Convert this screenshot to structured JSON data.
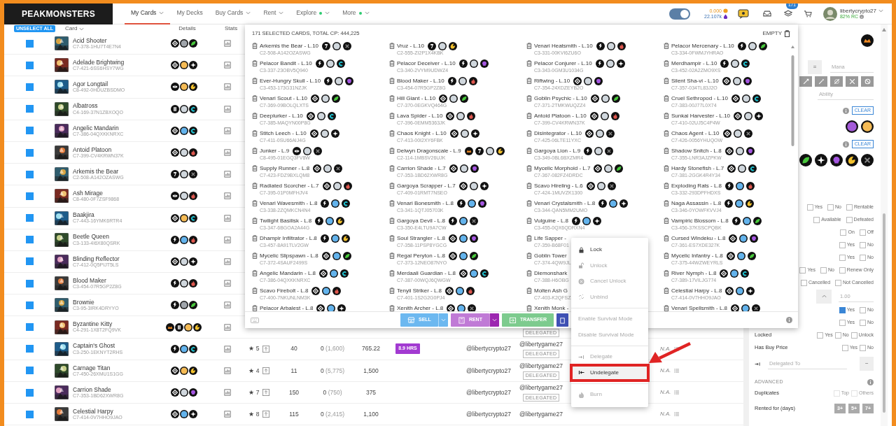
{
  "navbar": {
    "logo": "PEAKMONSTERS",
    "links": [
      {
        "label": "My Cards",
        "selected": true,
        "caret": true,
        "dot": false
      },
      {
        "label": "My Decks",
        "selected": false,
        "caret": false,
        "dot": false
      },
      {
        "label": "Buy Cards",
        "selected": false,
        "caret": true,
        "dot": false
      },
      {
        "label": "Rent",
        "selected": false,
        "caret": true,
        "dot": false
      },
      {
        "label": "Explore",
        "selected": false,
        "caret": true,
        "dot": true
      },
      {
        "label": "More",
        "selected": false,
        "caret": true,
        "dot": true
      }
    ],
    "toggle_on": true,
    "balance_primary": "0.000",
    "balance_secondary": "22.107k",
    "notifications": "171",
    "username": "libertycrypto27",
    "rc": "82% RC"
  },
  "table": {
    "unselect_all": "UNSELECT ALL",
    "columns": [
      "Card",
      "Details",
      "Stats"
    ],
    "rows": [
      {
        "selected": true,
        "name": "Acid Shooter",
        "id": "C7-378-1HU7T4E7N4",
        "icons": [
          {
            "kind": "chaos"
          },
          {
            "kind": "dark"
          },
          {
            "kind": "earth"
          }
        ]
      },
      {
        "selected": true,
        "name": "Adelade Brightwing",
        "id": "C7-421-6SS6HSY7WG",
        "icons": [
          {
            "kind": "chaos"
          },
          {
            "kind": "gold"
          },
          {
            "kind": "life"
          }
        ]
      },
      {
        "selected": true,
        "name": "Agor Longtail",
        "id": "C8-492-0HDUZBSDMO",
        "icons": [
          {
            "kind": "gladius"
          },
          {
            "kind": "gold"
          },
          {
            "kind": "dragon"
          }
        ]
      },
      {
        "selected": true,
        "name": "Albatross",
        "id": "C4-169-37N1ZBXOQO",
        "icons": [
          {
            "kind": "untamed"
          },
          {
            "kind": "silver"
          },
          {
            "kind": "water"
          }
        ]
      },
      {
        "selected": true,
        "name": "Angelic Mandarin",
        "id": "C7-386-04QXKKNRXC",
        "icons": [
          {
            "kind": "chaos"
          },
          {
            "kind": "blue"
          },
          {
            "kind": "water"
          }
        ]
      },
      {
        "selected": true,
        "name": "Antoid Platoon",
        "id": "C7-399-CV4KRWN37K",
        "icons": [
          {
            "kind": "chaos"
          },
          {
            "kind": "silver"
          },
          {
            "kind": "fire"
          }
        ]
      },
      {
        "selected": true,
        "name": "Arkemis the Bear",
        "id": "C2-508-A142OZASWG",
        "icons": [
          {
            "kind": "beta"
          },
          {
            "kind": "silver"
          },
          {
            "kind": "neutral"
          }
        ]
      },
      {
        "selected": true,
        "name": "Ash Mirage",
        "id": "C8-480-0F7ZSF9868",
        "icons": [
          {
            "kind": "gladius"
          },
          {
            "kind": "silver"
          },
          {
            "kind": "fire"
          }
        ]
      },
      {
        "selected": true,
        "name": "Baakjira",
        "id": "C7-443-16YMK6RTR4",
        "icons": [
          {
            "kind": "chaos"
          },
          {
            "kind": "gold"
          },
          {
            "kind": "water"
          }
        ]
      },
      {
        "selected": true,
        "name": "Beetle Queen",
        "id": "C3-133-4I6X80QSRK",
        "icons": [
          {
            "kind": "runner"
          },
          {
            "kind": "blue"
          },
          {
            "kind": "fire"
          }
        ]
      },
      {
        "selected": true,
        "name": "Blinding Reflector",
        "id": "C7-412-0Q5PIJT5LS",
        "icons": [
          {
            "kind": "chaos"
          },
          {
            "kind": "silver"
          },
          {
            "kind": "life"
          }
        ]
      },
      {
        "selected": true,
        "name": "Blood Maker",
        "id": "C3-454-07R5GP2Z8G",
        "icons": [
          {
            "kind": "runner"
          },
          {
            "kind": "silver"
          },
          {
            "kind": "fire"
          }
        ]
      },
      {
        "selected": true,
        "name": "Brownie",
        "id": "C3-95-3IRK4DRYYO",
        "icons": [
          {
            "kind": "runner"
          },
          {
            "kind": "dark"
          },
          {
            "kind": "earth"
          }
        ]
      },
      {
        "selected": true,
        "name": "Byzantine Kitty",
        "id": "C4-291-1X8T2FQ9VK",
        "icons": [
          {
            "kind": "reward"
          },
          {
            "kind": "untamed"
          },
          {
            "kind": "gold"
          },
          {
            "kind": "dragon"
          }
        ],
        "stats": {
          "delegated": "DELEGATED"
        }
      },
      {
        "selected": true,
        "name": "Captain's Ghost",
        "id": "C3-250-1EKNYT2RHS",
        "icons": [
          {
            "kind": "runner"
          },
          {
            "kind": "blue"
          },
          {
            "kind": "water"
          }
        ],
        "stats": {
          "rating": "★ 5",
          "cp": "40",
          "xp": "0",
          "xp_total": "(1,600)",
          "price": "765.22",
          "timer": "8.9 HRS",
          "owner": "@libertycrypto27",
          "delegatee": "@libertygame27",
          "delegated": "DELEGATED",
          "na": "N.A."
        }
      },
      {
        "selected": true,
        "name": "Carnage Titan",
        "id": "C7-450-26XMU1S1GG",
        "icons": [
          {
            "kind": "chaos"
          },
          {
            "kind": "gold"
          },
          {
            "kind": "dragon"
          }
        ],
        "stats": {
          "rating": "★ 4",
          "cp": "11",
          "xp": "0",
          "xp_total": "(5,775)",
          "price": "1,500",
          "owner": "@libertycrypto27",
          "delegatee": "@libertygame27",
          "delegated": "DELEGATED",
          "na": "N.A."
        }
      },
      {
        "selected": true,
        "name": "Carrion Shade",
        "id": "C7-353-1BD62XWR8G",
        "icons": [
          {
            "kind": "chaos"
          },
          {
            "kind": "silver"
          },
          {
            "kind": "death"
          }
        ],
        "stats": {
          "rating": "★ 7",
          "cp": "150",
          "xp": "0",
          "xp_total": "(750)",
          "price": "375",
          "owner": "@libertycrypto27",
          "delegatee": "@libertygame27",
          "delegated": "DELEGATED",
          "na": "N.A."
        }
      },
      {
        "selected": true,
        "name": "Celestial Harpy",
        "id": "C7-414-0V7HHO9JAO",
        "icons": [
          {
            "kind": "chaos"
          },
          {
            "kind": "blue"
          },
          {
            "kind": "life"
          }
        ],
        "stats": {
          "rating": "★ 8",
          "cp": "115",
          "xp": "0",
          "xp_total": "(2,415)",
          "price": "1,100",
          "owner": "@libertycrypto27",
          "delegatee": "@libertygame27",
          "na": "N.A."
        }
      }
    ]
  },
  "selection": {
    "summary": "171 SELECTED CARDS, TOTAL CP: 444,225",
    "empty": "EMPTY",
    "columns": [
      [
        {
          "name": "Arkemis the Bear - L.10",
          "id": "C2-508-A142OZASWG",
          "icons": [
            {
              "kind": "beta"
            },
            {
              "kind": "silver"
            },
            {
              "kind": "neutral"
            }
          ]
        },
        {
          "name": "Pelacor Bandit - L.10",
          "id": "C3-337-23OBV5Q940",
          "icons": [
            {
              "kind": "runner"
            },
            {
              "kind": "silver"
            },
            {
              "kind": "water"
            }
          ]
        },
        {
          "name": "Ever-Hungry Skull - L.10",
          "id": "C3-453-173G31NZJK",
          "icons": [
            {
              "kind": "runner"
            },
            {
              "kind": "silver"
            },
            {
              "kind": "death"
            }
          ]
        },
        {
          "name": "Venari Scout - L.10",
          "id": "C7-369-09BOLQLXTS",
          "icons": [
            {
              "kind": "chaos"
            },
            {
              "kind": "silver"
            },
            {
              "kind": "earth"
            }
          ]
        },
        {
          "name": "Deeplurker - L.10",
          "id": "C7-385-MAQYN00P8G",
          "icons": [
            {
              "kind": "chaos"
            },
            {
              "kind": "silver"
            },
            {
              "kind": "water"
            }
          ]
        },
        {
          "name": "Stitch Leech - L.10",
          "id": "C7-411-0SU66AIJ4G",
          "icons": [
            {
              "kind": "chaos"
            },
            {
              "kind": "silver"
            },
            {
              "kind": "life"
            }
          ]
        },
        {
          "name": "Junker - L.9",
          "id": "C8-495-01EGQ3FV8W",
          "icons": [
            {
              "kind": "gladius"
            },
            {
              "kind": "silver"
            },
            {
              "kind": "neutral"
            }
          ]
        },
        {
          "name": "Supply Runner - L.8",
          "id": "C7-423-FDZ9BXLQM8",
          "icons": [
            {
              "kind": "chaos"
            },
            {
              "kind": "silver"
            },
            {
              "kind": "neutral"
            }
          ]
        },
        {
          "name": "Radiated Scorcher - L.7",
          "id": "C7-395-01P0MFHJV4",
          "icons": [
            {
              "kind": "chaos"
            },
            {
              "kind": "silver"
            },
            {
              "kind": "fire"
            }
          ]
        },
        {
          "name": "Venari Wavesmith - L.8",
          "id": "C3-338-2ZQMKCN4N4",
          "icons": [
            {
              "kind": "runner"
            },
            {
              "kind": "blue"
            },
            {
              "kind": "water"
            }
          ]
        },
        {
          "name": "Twilight Basilisk - L.8",
          "id": "C3-347-6BGOA2A44G",
          "icons": [
            {
              "kind": "runner"
            },
            {
              "kind": "blue"
            },
            {
              "kind": "dragon"
            }
          ]
        },
        {
          "name": "Dhampir Infiltrator - L.8",
          "id": "C3-457-8A91TLV2GW",
          "icons": [
            {
              "kind": "runner"
            },
            {
              "kind": "blue"
            },
            {
              "kind": "dragon"
            }
          ]
        },
        {
          "name": "Mycelic Slipspawn - L.8",
          "id": "C7-372-4SAUF2499S",
          "icons": [
            {
              "kind": "chaos"
            },
            {
              "kind": "blue"
            },
            {
              "kind": "earth"
            }
          ]
        },
        {
          "name": "Angelic Mandarin - L.8",
          "id": "C7-386-04QXKKNRXC",
          "icons": [
            {
              "kind": "chaos"
            },
            {
              "kind": "blue"
            },
            {
              "kind": "water"
            }
          ]
        },
        {
          "name": "Scavo Firebolt - L.8",
          "id": "C7-400-7NKUNLNM3K",
          "icons": [
            {
              "kind": "chaos"
            },
            {
              "kind": "blue"
            },
            {
              "kind": "fire"
            }
          ]
        },
        {
          "name": "Pelacor Arbalest - L.8",
          "icons": [
            {
              "kind": "chaos"
            },
            {
              "kind": "blue"
            },
            {
              "kind": "life"
            }
          ]
        }
      ],
      [
        {
          "name": "Vruz - L.10",
          "id": "C2-555-ZI2P1X4KBK",
          "icons": [
            {
              "kind": "beta"
            },
            {
              "kind": "silver"
            },
            {
              "kind": "dragon"
            }
          ]
        },
        {
          "name": "Pelacor Deceiver - L.10",
          "id": "C3-340-2VYM9UDWZ4",
          "icons": [
            {
              "kind": "runner"
            },
            {
              "kind": "silver"
            },
            {
              "kind": "death"
            }
          ]
        },
        {
          "name": "Blood Maker - L.10",
          "id": "C3-454-07R5GP2Z8G",
          "icons": [
            {
              "kind": "runner"
            },
            {
              "kind": "silver"
            },
            {
              "kind": "fire"
            }
          ]
        },
        {
          "name": "Hill Giant - L.10",
          "id": "C7-370-0EGKVQ464G",
          "icons": [
            {
              "kind": "chaos"
            },
            {
              "kind": "silver"
            },
            {
              "kind": "earth"
            }
          ]
        },
        {
          "name": "Lava Spider - L.10",
          "id": "C7-396-0EMM5363JK",
          "icons": [
            {
              "kind": "chaos"
            },
            {
              "kind": "silver"
            },
            {
              "kind": "fire"
            }
          ]
        },
        {
          "name": "Chaos Knight - L.10",
          "id": "C7-413-00I2XY6FBK",
          "icons": [
            {
              "kind": "chaos"
            },
            {
              "kind": "silver"
            },
            {
              "kind": "life"
            }
          ]
        },
        {
          "name": "Delwyn Dragonscale - L.9",
          "id": "C2-114-1MBSV26UJK",
          "icons": [
            {
              "kind": "reward"
            },
            {
              "kind": "beta"
            },
            {
              "kind": "silver"
            },
            {
              "kind": "dragon"
            }
          ]
        },
        {
          "name": "Carrion Shade - L.7",
          "id": "C7-353-1BD62XWR8G",
          "icons": [
            {
              "kind": "chaos"
            },
            {
              "kind": "silver"
            },
            {
              "kind": "death"
            }
          ]
        },
        {
          "name": "Gargoya Scrapper - L.7",
          "id": "C7-409-01RMT7NSEO",
          "icons": [
            {
              "kind": "chaos"
            },
            {
              "kind": "silver"
            },
            {
              "kind": "life"
            }
          ]
        },
        {
          "name": "Venari Bonesmith - L.8",
          "id": "C3-341-1QTJ05703K",
          "icons": [
            {
              "kind": "runner"
            },
            {
              "kind": "blue"
            },
            {
              "kind": "death"
            }
          ]
        },
        {
          "name": "Gargoya Devil - L.8",
          "id": "C3-350-E4LTU9A7CW",
          "icons": [
            {
              "kind": "runner"
            },
            {
              "kind": "blue"
            },
            {
              "kind": "neutral"
            }
          ]
        },
        {
          "name": "Soul Strangler - L.8",
          "id": "C7-358-11PSP8YGCG",
          "icons": [
            {
              "kind": "chaos"
            },
            {
              "kind": "blue"
            },
            {
              "kind": "death"
            }
          ]
        },
        {
          "name": "Regal Peryton - L.8",
          "id": "C7-373-12NEO87NYO",
          "icons": [
            {
              "kind": "chaos"
            },
            {
              "kind": "blue"
            },
            {
              "kind": "earth"
            }
          ]
        },
        {
          "name": "Merdaali Guardian - L.8",
          "id": "C7-387-00WQJ6QWGW",
          "icons": [
            {
              "kind": "chaos"
            },
            {
              "kind": "blue"
            },
            {
              "kind": "water"
            }
          ]
        },
        {
          "name": "Tenyii Striker - L.8",
          "id": "C7-401-1S2G2G0PJ4",
          "icons": [
            {
              "kind": "chaos"
            },
            {
              "kind": "blue"
            },
            {
              "kind": "fire"
            }
          ]
        },
        {
          "name": "Xenith Archer - L.8",
          "icons": [
            {
              "kind": "chaos"
            },
            {
              "kind": "blue"
            },
            {
              "kind": "neutral"
            }
          ]
        }
      ],
      [
        {
          "name": "Venari Heatsmith - L.10",
          "id": "C3-331-00KVI6ZU6O",
          "icons": [
            {
              "kind": "runner"
            },
            {
              "kind": "silver"
            },
            {
              "kind": "fire"
            }
          ]
        },
        {
          "name": "Pelacor Conjurer - L.10",
          "id": "C3-343-0GM3U1034G",
          "icons": [
            {
              "kind": "runner"
            },
            {
              "kind": "silver"
            },
            {
              "kind": "life"
            }
          ]
        },
        {
          "name": "Riftwing - L.10",
          "id": "C7-354-24XDZEYB2O",
          "icons": [
            {
              "kind": "chaos"
            },
            {
              "kind": "silver"
            },
            {
              "kind": "death"
            }
          ]
        },
        {
          "name": "Goblin Psychic - L.10",
          "id": "C7-371-2TMKWUQZZ4",
          "icons": [
            {
              "kind": "chaos"
            },
            {
              "kind": "silver"
            },
            {
              "kind": "earth"
            }
          ]
        },
        {
          "name": "Antoid Platoon - L.10",
          "id": "C7-399-CV4KRWN37K",
          "icons": [
            {
              "kind": "chaos"
            },
            {
              "kind": "silver"
            },
            {
              "kind": "fire"
            }
          ]
        },
        {
          "name": "Disintegrator - L.10",
          "id": "C7-425-06LTE11YXC",
          "icons": [
            {
              "kind": "chaos"
            },
            {
              "kind": "silver"
            },
            {
              "kind": "neutral"
            }
          ]
        },
        {
          "name": "Gargoya Lion - L.9",
          "id": "C3-349-0BL6BXZMR4",
          "icons": [
            {
              "kind": "runner"
            },
            {
              "kind": "silver"
            },
            {
              "kind": "neutral"
            }
          ]
        },
        {
          "name": "Mycelic Morphoid - L.7",
          "id": "C7-367-082FZ4DRDC",
          "icons": [
            {
              "kind": "chaos"
            },
            {
              "kind": "silver"
            },
            {
              "kind": "earth"
            }
          ]
        },
        {
          "name": "Scavo Hireling - L.6",
          "id": "C7-424-1MUVZK1300",
          "icons": [
            {
              "kind": "chaos"
            },
            {
              "kind": "silver"
            },
            {
              "kind": "neutral"
            }
          ]
        },
        {
          "name": "Venari Crystalsmith - L.8",
          "id": "C3-344-QAN5MM2UMO",
          "icons": [
            {
              "kind": "runner"
            },
            {
              "kind": "blue"
            },
            {
              "kind": "life"
            }
          ]
        },
        {
          "name": "Vulguine - L.8",
          "id": "C3-455-0QX6QDRXN4",
          "icons": [
            {
              "kind": "runner"
            },
            {
              "kind": "blue"
            },
            {
              "kind": "life"
            }
          ]
        },
        {
          "name": "Life Sapper -",
          "id": "C7-359-B68F01"
        },
        {
          "name": "Goblin Tower",
          "id": "C7-374-4QW9JL"
        },
        {
          "name": "Diemonshark",
          "id": "C7-388-H6OBG"
        },
        {
          "name": "Molten Ash G",
          "id": "C7-403-K2QFSZ"
        },
        {
          "name": "Xenith Monk -"
        }
      ],
      [
        {
          "name": "Pelacor Mercenary - L.10",
          "id": "C3-334-0FWMJYHRAO",
          "icons": [
            {
              "kind": "runner"
            },
            {
              "kind": "silver"
            },
            {
              "kind": "earth"
            }
          ]
        },
        {
          "name": "Merdhampir - L.10",
          "id": "C3-452-02A2ZMO9XS",
          "icons": [
            {
              "kind": "runner"
            },
            {
              "kind": "silver"
            },
            {
              "kind": "water"
            }
          ]
        },
        {
          "name": "Silent Sha-vi - L.10",
          "id": "C7-357-034TL83J2O",
          "icons": [
            {
              "kind": "chaos"
            },
            {
              "kind": "silver"
            },
            {
              "kind": "death"
            }
          ]
        },
        {
          "name": "Cruel Sethropod - L.10",
          "id": "C7-383-00J77L0X74",
          "icons": [
            {
              "kind": "chaos"
            },
            {
              "kind": "silver"
            },
            {
              "kind": "water"
            }
          ]
        },
        {
          "name": "Sunkai Harvester - L.10",
          "id": "C7-410-02UJ5C4P4W",
          "icons": [
            {
              "kind": "chaos"
            },
            {
              "kind": "silver"
            },
            {
              "kind": "life"
            }
          ]
        },
        {
          "name": "Chaos Agent - L.10",
          "id": "C7-426-0056YHUQOW",
          "icons": [
            {
              "kind": "chaos"
            },
            {
              "kind": "silver"
            },
            {
              "kind": "neutral"
            }
          ]
        },
        {
          "name": "Shadow Snitch - L.8",
          "id": "C7-355-LNR3AJZPKW",
          "icons": [
            {
              "kind": "chaos"
            },
            {
              "kind": "silver"
            },
            {
              "kind": "death"
            }
          ]
        },
        {
          "name": "Hardy Stonefish - L.7",
          "id": "C7-381-2GGK4R4Y34",
          "icons": [
            {
              "kind": "chaos"
            },
            {
              "kind": "silver"
            },
            {
              "kind": "water"
            }
          ]
        },
        {
          "name": "Exploding Rats - L.8",
          "id": "C3-332-293DPFHDXS",
          "icons": [
            {
              "kind": "runner"
            },
            {
              "kind": "blue"
            },
            {
              "kind": "fire"
            }
          ]
        },
        {
          "name": "Naga Assassin - L.8",
          "id": "C3-346-0YOWFKVVJ4",
          "icons": [
            {
              "kind": "runner"
            },
            {
              "kind": "blue"
            },
            {
              "kind": "dragon"
            }
          ]
        },
        {
          "name": "Vampiric Blossom - L.8",
          "id": "C3-456-37KSSCPQBK",
          "icons": [
            {
              "kind": "runner"
            },
            {
              "kind": "blue"
            },
            {
              "kind": "earth"
            }
          ]
        },
        {
          "name": "Cursed Windeku - L.8",
          "id": "C7-361-ES7XDE327K",
          "icons": [
            {
              "kind": "chaos"
            },
            {
              "kind": "blue"
            },
            {
              "kind": "death"
            }
          ]
        },
        {
          "name": "Mycelic Infantry - L.8",
          "id": "C7-375-44WZWEYRLS",
          "icons": [
            {
              "kind": "chaos"
            },
            {
              "kind": "blue"
            },
            {
              "kind": "earth"
            }
          ]
        },
        {
          "name": "River Nymph - L.8",
          "id": "C7-389-17VILJG774",
          "icons": [
            {
              "kind": "chaos"
            },
            {
              "kind": "blue"
            },
            {
              "kind": "water"
            }
          ]
        },
        {
          "name": "Celestial Harpy - L.8",
          "id": "C7-414-0V7HHO9JAO",
          "icons": [
            {
              "kind": "chaos"
            },
            {
              "kind": "blue"
            },
            {
              "kind": "life"
            }
          ]
        },
        {
          "name": "Venari Spellsmith - L.8",
          "icons": [
            {
              "kind": "chaos"
            },
            {
              "kind": "blue"
            },
            {
              "kind": "neutral"
            }
          ]
        }
      ]
    ],
    "actions": [
      {
        "kind": "sell",
        "label": "SELL",
        "split": true
      },
      {
        "kind": "rent",
        "label": "RENT",
        "split": true
      },
      {
        "kind": "transfer",
        "label": "TRANSFER",
        "split": false
      },
      {
        "kind": "more",
        "split": false
      }
    ]
  },
  "menu": [
    {
      "kind": "lock",
      "label": "Lock",
      "disabled": false,
      "highlighted": false
    },
    {
      "kind": "unlock",
      "label": "Unlock",
      "disabled": true,
      "highlighted": false
    },
    {
      "kind": "cancel",
      "label": "Cancel Unlock",
      "disabled": true,
      "highlighted": false
    },
    {
      "kind": "unbind",
      "label": "Unbind",
      "disabled": true,
      "highlighted": false
    },
    {
      "kind": "divider"
    },
    {
      "kind": "plain",
      "label": "Enable Survival Mode",
      "disabled": true,
      "highlighted": false
    },
    {
      "kind": "plain",
      "label": "Disable Survival Mode",
      "disabled": true,
      "highlighted": false
    },
    {
      "kind": "divider"
    },
    {
      "kind": "delegate",
      "label": "Delegate",
      "disabled": true,
      "highlighted": false
    },
    {
      "kind": "undelegate",
      "label": "Undelegate",
      "disabled": false,
      "highlighted": true
    },
    {
      "kind": "divider"
    },
    {
      "kind": "burn",
      "label": "Burn",
      "disabled": true,
      "highlighted": false
    }
  ],
  "filters": [
    {
      "kind": "icons",
      "icons": [
        {
          "kind": "reward"
        }
      ]
    },
    {
      "kind": "mana",
      "button": "=",
      "placeholder": "Mana"
    },
    {
      "kind": "abilities"
    },
    {
      "kind": "field",
      "placeholder": "Ability"
    },
    {
      "kind": "clear",
      "label": "CLEAR"
    },
    {
      "kind": "icons",
      "icons": [
        {
          "kind": "epic"
        },
        {
          "kind": "gold"
        }
      ]
    },
    {
      "kind": "clear",
      "label": "CLEAR"
    },
    {
      "kind": "icons",
      "icons": [
        {
          "kind": "earth"
        },
        {
          "kind": "life"
        },
        {
          "kind": "death"
        },
        {
          "kind": "dragon"
        },
        {
          "kind": "neutral"
        }
      ]
    },
    {
      "kind": "checks",
      "options": [
        {
          "label": "Yes",
          "checked": false
        },
        {
          "label": "No",
          "checked": false
        },
        {
          "label": "Rentable",
          "checked": false
        }
      ]
    },
    {
      "kind": "checks",
      "options": [
        {
          "label": "Available",
          "checked": false
        },
        {
          "label": "Defeated",
          "checked": false
        }
      ]
    },
    {
      "kind": "checks",
      "options": [
        {
          "label": "On",
          "checked": false
        },
        {
          "label": "Off",
          "checked": false
        }
      ]
    },
    {
      "kind": "checks",
      "options": [
        {
          "label": "Yes",
          "checked": false
        },
        {
          "label": "No",
          "checked": false
        }
      ]
    },
    {
      "kind": "checks",
      "options": [
        {
          "label": "Yes",
          "checked": false
        },
        {
          "label": "No",
          "checked": false
        }
      ]
    },
    {
      "kind": "checks",
      "options": [
        {
          "label": "Yes",
          "checked": false
        },
        {
          "label": "No",
          "checked": false
        },
        {
          "label": "Renew Only",
          "checked": false
        }
      ]
    },
    {
      "kind": "checks",
      "options": [
        {
          "label": "Cancelled",
          "checked": false
        },
        {
          "label": "Not Cancelled",
          "checked": false
        }
      ]
    },
    {
      "kind": "stepper",
      "placeholder": "1.00"
    },
    {
      "kind": "checks",
      "options": [
        {
          "label": "Yes",
          "checked": true
        },
        {
          "label": "No",
          "checked": false
        }
      ]
    },
    {
      "kind": "checks",
      "options": [
        {
          "label": "Yes",
          "checked": false
        },
        {
          "label": "No",
          "checked": false
        }
      ]
    },
    {
      "kind": "checks",
      "label": "Locked",
      "options": [
        {
          "label": "Yes",
          "checked": false
        },
        {
          "label": "No",
          "checked": false
        },
        {
          "label": "Unlock",
          "checked": false
        }
      ]
    },
    {
      "kind": "checks",
      "label": "Has Buy Price",
      "options": [
        {
          "label": "Yes",
          "checked": false
        },
        {
          "label": "No",
          "checked": false
        }
      ]
    },
    {
      "kind": "delegated",
      "placeholder": "Delegated To",
      "button": "~"
    },
    {
      "kind": "section",
      "label": "ADVANCED"
    },
    {
      "kind": "checks",
      "label": "Duplicates",
      "disabled": true,
      "options": [
        {
          "label": "Top",
          "checked": false
        },
        {
          "label": "Others",
          "checked": false
        }
      ]
    },
    {
      "kind": "days",
      "label": "Rented for (days)",
      "buttons": [
        "3+",
        "5+",
        "7+"
      ]
    }
  ]
}
